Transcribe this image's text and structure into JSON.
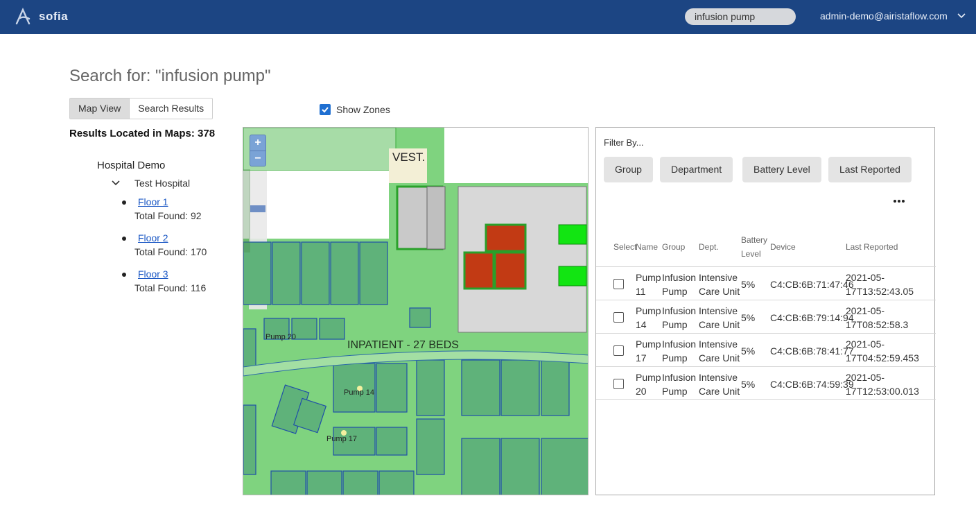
{
  "header": {
    "app_name": "sofia",
    "search_value": "infusion pump",
    "user": "admin-demo@airistaflow.com"
  },
  "page": {
    "title": "Search for: \"infusion pump\"",
    "tabs": [
      {
        "label": "Map View"
      },
      {
        "label": "Search Results"
      }
    ],
    "results_count": "Results Located in Maps: 378"
  },
  "tree": {
    "root": "Hospital Demo",
    "hospital": "Test Hospital",
    "floors": [
      {
        "label": "Floor 1",
        "found": "Total Found: 92"
      },
      {
        "label": "Floor 2",
        "found": "Total Found: 170"
      },
      {
        "label": "Floor 3",
        "found": "Total Found: 116"
      }
    ]
  },
  "map": {
    "show_zones_label": "Show Zones",
    "show_zones_checked": true,
    "zoom_in": "+",
    "zoom_out": "−",
    "labels": {
      "vest": "VEST.",
      "inpatient": "INPATIENT - 27 BEDS",
      "pump20": "Pump 20",
      "pump14": "Pump 14",
      "pump17": "Pump 17"
    }
  },
  "panel": {
    "filter_label": "Filter By...",
    "filters": [
      "Group",
      "Department",
      "Battery Level",
      "Last Reported"
    ],
    "columns": {
      "select": "Select",
      "name": "Name",
      "group": "Group",
      "dept": "Dept.",
      "battery_1": "Battery",
      "battery_2": "Level",
      "device": "Device",
      "last_reported": "Last Reported"
    },
    "rows": [
      {
        "name_1": "Pump",
        "name_2": "11",
        "group_1": "Infusion",
        "group_2": "Pump",
        "dept_1": "Intensive",
        "dept_2": "Care Unit",
        "battery": "5%",
        "device": "C4:CB:6B:71:47:46",
        "last_1": "2021-05-",
        "last_2": "17T13:52:43.05"
      },
      {
        "name_1": "Pump",
        "name_2": "14",
        "group_1": "Infusion",
        "group_2": "Pump",
        "dept_1": "Intensive",
        "dept_2": "Care Unit",
        "battery": "5%",
        "device": "C4:CB:6B:79:14:94",
        "last_1": "2021-05-",
        "last_2": "17T08:52:58.3"
      },
      {
        "name_1": "Pump",
        "name_2": "17",
        "group_1": "Infusion",
        "group_2": "Pump",
        "dept_1": "Intensive",
        "dept_2": "Care Unit",
        "battery": "5%",
        "device": "C4:CB:6B:78:41:77",
        "last_1": "2021-05-",
        "last_2": "17T04:52:59.453"
      },
      {
        "name_1": "Pump",
        "name_2": "20",
        "group_1": "Infusion",
        "group_2": "Pump",
        "dept_1": "Intensive",
        "dept_2": "Care Unit",
        "battery": "5%",
        "device": "C4:CB:6B:74:59:39",
        "last_1": "2021-05-",
        "last_2": "17T12:53:00.013"
      }
    ]
  },
  "colors": {
    "header_bg": "#1c4583",
    "zone_green": "#7fd37f",
    "alert_red": "#c0391a",
    "link_blue": "#1a57c4"
  }
}
